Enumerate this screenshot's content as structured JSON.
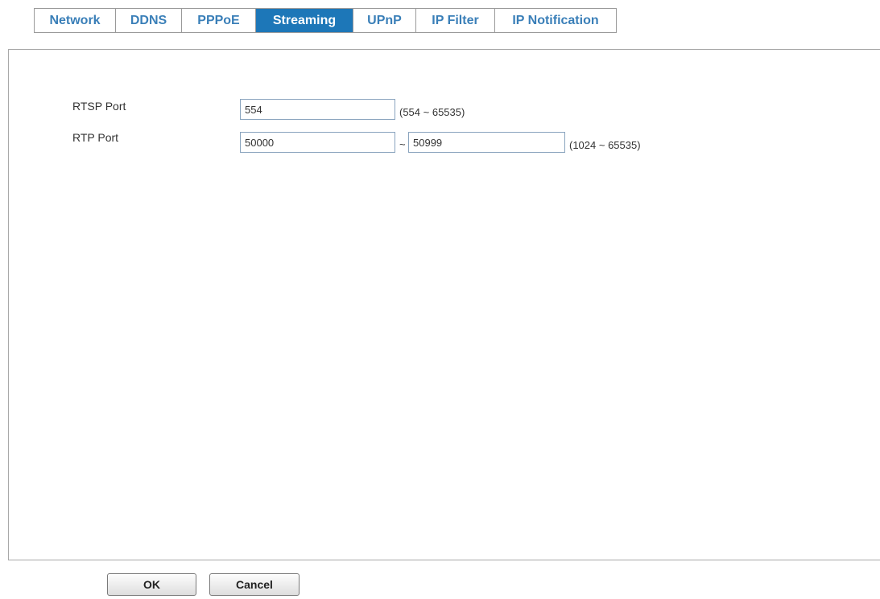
{
  "tabs": [
    {
      "label": "Network",
      "active": false
    },
    {
      "label": "DDNS",
      "active": false
    },
    {
      "label": "PPPoE",
      "active": false
    },
    {
      "label": "Streaming",
      "active": true
    },
    {
      "label": "UPnP",
      "active": false
    },
    {
      "label": "IP Filter",
      "active": false
    },
    {
      "label": "IP Notification",
      "active": false
    }
  ],
  "streaming": {
    "rtsp_port": {
      "label": "RTSP Port",
      "value": "554",
      "range_hint": "(554 ~ 65535)"
    },
    "rtp_port": {
      "label": "RTP Port",
      "start_value": "50000",
      "separator": "~",
      "end_value": "50999",
      "range_hint": "(1024 ~ 65535)"
    }
  },
  "buttons": {
    "ok_label": "OK",
    "cancel_label": "Cancel"
  },
  "colors": {
    "tab_text": "#3a7fb8",
    "tab_active_bg": "#1d77b8",
    "tab_active_text": "#ffffff"
  }
}
